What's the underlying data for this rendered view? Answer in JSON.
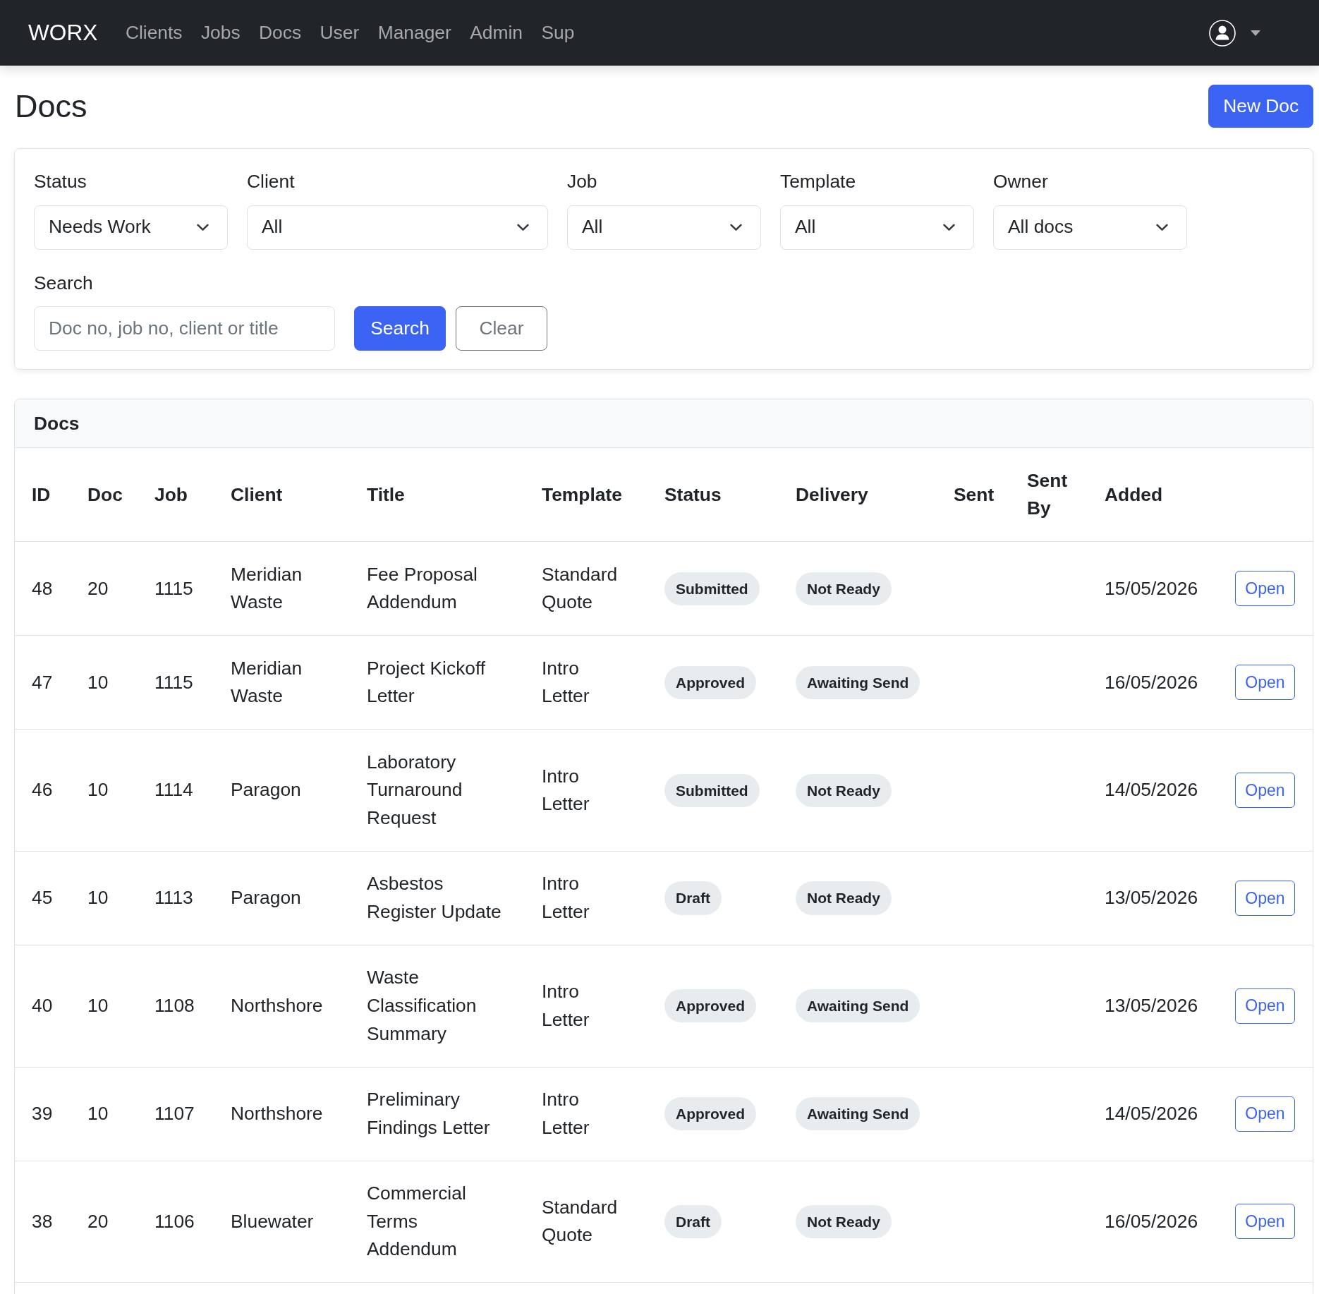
{
  "navbar": {
    "brand": "WORX",
    "links": [
      {
        "label": "Clients"
      },
      {
        "label": "Jobs"
      },
      {
        "label": "Docs"
      },
      {
        "label": "User"
      },
      {
        "label": "Manager"
      },
      {
        "label": "Admin"
      },
      {
        "label": "Sup"
      }
    ]
  },
  "page": {
    "title": "Docs",
    "new_button": "New Doc"
  },
  "filters": {
    "selects": [
      {
        "label": "Status",
        "value": "Needs Work"
      },
      {
        "label": "Client",
        "value": "All"
      },
      {
        "label": "Job",
        "value": "All"
      },
      {
        "label": "Template",
        "value": "All"
      },
      {
        "label": "Owner",
        "value": "All docs"
      }
    ],
    "search": {
      "label": "Search",
      "placeholder": "Doc no, job no, client or title"
    },
    "buttons": [
      {
        "label": "Search",
        "kind": "primary"
      },
      {
        "label": "Clear",
        "kind": "secondary"
      }
    ]
  },
  "table": {
    "title": "Docs",
    "columns": [
      "ID",
      "Doc",
      "Job",
      "Client",
      "Title",
      "Template",
      "Status",
      "Delivery",
      "Sent",
      "Sent By",
      "Added"
    ],
    "rows": [
      {
        "id": "48",
        "doc": "20",
        "job": "1115",
        "client": "Meridian Waste",
        "title": "Fee Proposal Addendum",
        "template": "Standard Quote",
        "status": "Submitted",
        "delivery": "Not Ready",
        "added": "15/05/2026",
        "action": "Open"
      },
      {
        "id": "47",
        "doc": "10",
        "job": "1115",
        "client": "Meridian Waste",
        "title": "Project Kickoff Letter",
        "template": "Intro Letter",
        "status": "Approved",
        "delivery": "Awaiting Send",
        "added": "16/05/2026",
        "action": "Open"
      },
      {
        "id": "46",
        "doc": "10",
        "job": "1114",
        "client": "Paragon",
        "title": "Laboratory Turnaround Request",
        "template": "Intro Letter",
        "status": "Submitted",
        "delivery": "Not Ready",
        "added": "14/05/2026",
        "action": "Open"
      },
      {
        "id": "45",
        "doc": "10",
        "job": "1113",
        "client": "Paragon",
        "title": "Asbestos Register Update",
        "template": "Intro Letter",
        "status": "Draft",
        "delivery": "Not Ready",
        "added": "13/05/2026",
        "action": "Open"
      },
      {
        "id": "40",
        "doc": "10",
        "job": "1108",
        "client": "Northshore",
        "title": "Waste Classification Summary",
        "template": "Intro Letter",
        "status": "Approved",
        "delivery": "Awaiting Send",
        "added": "13/05/2026",
        "action": "Open"
      },
      {
        "id": "39",
        "doc": "10",
        "job": "1107",
        "client": "Northshore",
        "title": "Preliminary Findings Letter",
        "template": "Intro Letter",
        "status": "Approved",
        "delivery": "Awaiting Send",
        "added": "14/05/2026",
        "action": "Open"
      },
      {
        "id": "38",
        "doc": "20",
        "job": "1106",
        "client": "Bluewater",
        "title": "Commercial Terms Addendum",
        "template": "Standard Quote",
        "status": "Draft",
        "delivery": "Not Ready",
        "added": "16/05/2026",
        "action": "Open"
      }
    ]
  }
}
